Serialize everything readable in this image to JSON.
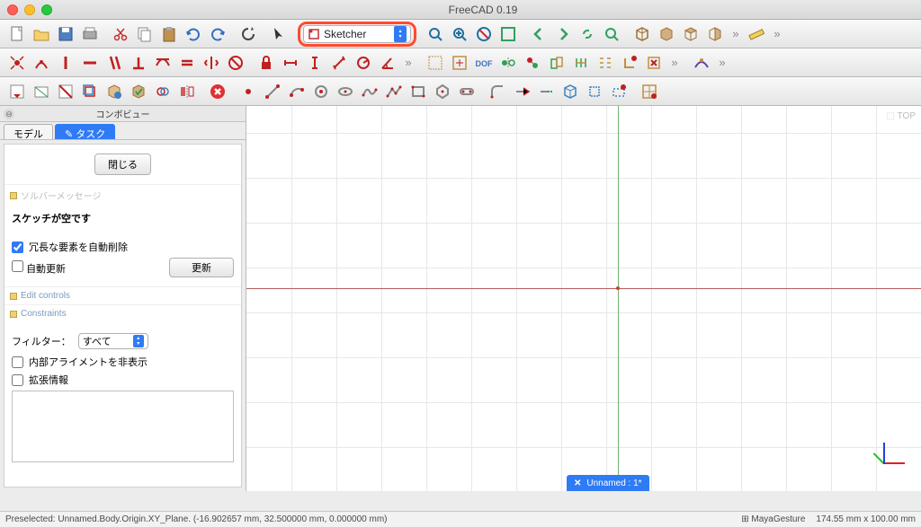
{
  "title": "FreeCAD 0.19",
  "workbench": "Sketcher",
  "panel": {
    "title": "コンボビュー",
    "tabs": {
      "model": "モデル",
      "task": "タスク"
    },
    "close_btn": "閉じる",
    "solver_section": "ソルバーメッセージ",
    "empty_msg": "スケッチが空です",
    "autodelete": "冗長な要素を自動削除",
    "autoupdate": "自動更新",
    "update_btn": "更新",
    "edit_controls": "Edit controls",
    "constraints": "Constraints",
    "filter_label": "フィルター：",
    "filter_value": "すべて",
    "hide_internal": "内部アライメントを非表示",
    "extended": "拡張情報"
  },
  "active_tab": "Unnamed : 1*",
  "statusbar": {
    "preselect": "Preselected: Unnamed.Body.Origin.XY_Plane. (-16.902657 mm, 32.500000 mm, 0.000000 mm)",
    "nav": "MayaGesture",
    "dims": "174.55 mm x 100.00 mm"
  },
  "colors": {
    "accent": "#2f7bf5",
    "highlight": "#ff4a2f"
  }
}
